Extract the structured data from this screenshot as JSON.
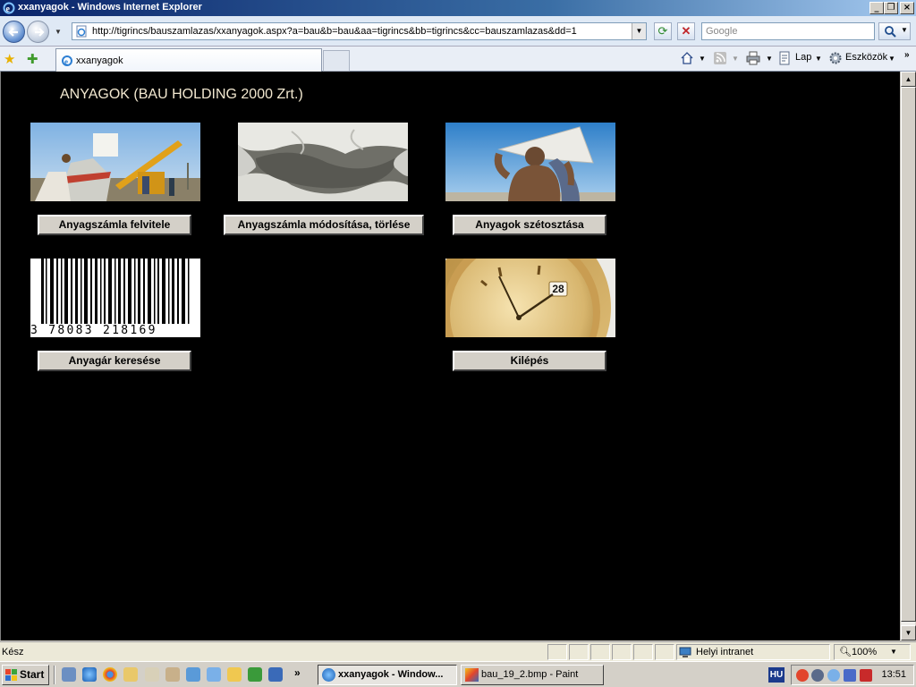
{
  "window": {
    "title": "xxanyagok - Windows Internet Explorer"
  },
  "navigation": {
    "url": "http://tigrincs/bauszamlazas/xxanyagok.aspx?a=bau&b=bau&aa=tigrincs&bb=tigrincs&cc=bauszamlazas&dd=1",
    "search_placeholder": "Google"
  },
  "tabs": [
    {
      "label": "xxanyagok"
    }
  ],
  "command_bar": {
    "page_label": "Lap",
    "tools_label": "Eszközök"
  },
  "page": {
    "title": "ANYAGOK (BAU HOLDING 2000 Zrt.)",
    "buttons": [
      {
        "label": "Anyagszámla felvitele"
      },
      {
        "label": "Anyagszámla módosítása, törlése"
      },
      {
        "label": "Anyagok szétosztása"
      },
      {
        "label": "Anyagár keresése"
      },
      {
        "label": "Kilépés"
      }
    ],
    "barcode_digits": "3 78083 218169"
  },
  "status_bar": {
    "status": "Kész",
    "zone": "Helyi intranet",
    "zoom": "100%"
  },
  "taskbar": {
    "start_label": "Start",
    "items": [
      {
        "label": "xxanyagok - Window..."
      },
      {
        "label": "bau_19_2.bmp - Paint"
      }
    ],
    "language": "HU",
    "clock": "13:51"
  },
  "colors": {
    "page_background": "#000000",
    "title_text": "#f2e8d0",
    "titlebar_start": "#0a246a",
    "button_face": "#d4d0c8"
  }
}
